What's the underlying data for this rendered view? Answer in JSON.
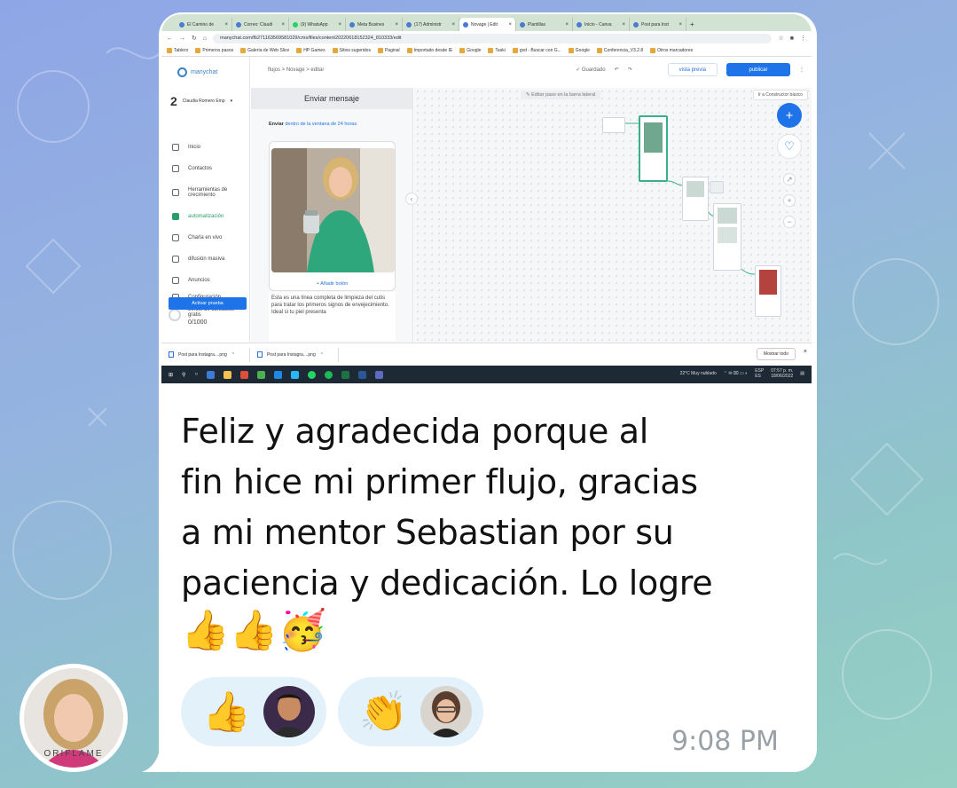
{
  "browser": {
    "tabs": [
      {
        "label": "El Camino de"
      },
      {
        "label": "Correo: Claudi"
      },
      {
        "label": "(9) WhatsApp"
      },
      {
        "label": "Meta Busines"
      },
      {
        "label": "(17) Administr"
      },
      {
        "label": "Novage | Edit",
        "active": true
      },
      {
        "label": "Plantillas"
      },
      {
        "label": "Inicio - Canva"
      },
      {
        "label": "Post para Inst"
      }
    ],
    "url": "manychat.com/fb271163569581029/cms/files/content20220618152324_810333/edit",
    "bookmarks": [
      "Tablero",
      "Primeros pasos",
      "Galería de Web Slice",
      "HP Games",
      "Sitios sugeridos",
      "Paginal",
      "Importado desde IE",
      "Google",
      "Taski",
      "gvd - Buscar con G...",
      "Google",
      "Conferencia_V3.2.8",
      "Otros marcadores"
    ]
  },
  "app": {
    "brand": "manychat",
    "account_name": "Claudia Romero Emp",
    "account_number": "2",
    "nav": [
      {
        "label": "Inicio"
      },
      {
        "label": "Contactos"
      },
      {
        "label": "Herramientas de crecimiento"
      },
      {
        "label": "automatización",
        "selected": true
      },
      {
        "label": "Charla en vivo"
      },
      {
        "label": "difusión masiva"
      },
      {
        "label": "Anuncios"
      },
      {
        "label": "Configuración"
      }
    ],
    "limit_label": "Límite de contactos gratis",
    "limit_value": "0/1000",
    "trial_button": "Activar prueba",
    "breadcrumb": "flujos  >  Novage  >  editar",
    "saved": "Guardado",
    "preview_button": "vista previa",
    "publish_button": "publicar",
    "basic_builder": "Ir a Constructor básico",
    "panel_title": "Enviar mensaje",
    "panel_send_prefix": "Enviar",
    "panel_send_window": "dentro de la ventana de 24 horas",
    "add_button": "+ Añadir botón",
    "message_text": "Esta es una línea completa de limpieza del cutis para tratar los primeros signos de envejecimiento. Ideal si tu piel presenta",
    "canvas_hint": "Editar paso en la barra lateral"
  },
  "downloads": {
    "items": [
      "Post para Instagra....png",
      "Post para Instagra....png"
    ],
    "show_all": "Mostrar todo"
  },
  "taskbar": {
    "weather": "22°C  Muy nublado",
    "lang": "ESP",
    "lang2": "ES",
    "clock": "07:57 p. m.",
    "date": "18/06/2022"
  },
  "message": {
    "lines": [
      "Feliz y agradecida porque al",
      "fin hice mi primer flujo, gracias",
      "a mi mentor Sebastian por su",
      "paciencia y dedicación. Lo logre"
    ],
    "emojis": "👍👍🥳",
    "time": "9:08 PM"
  },
  "reactions": [
    {
      "emoji": "👍"
    },
    {
      "emoji": "👏"
    }
  ],
  "avatar": {
    "label": "ORIFLAME"
  },
  "colors": {
    "accent_blue": "#1e73e8",
    "selected_green": "#2a9d6b",
    "reaction_bg": "#e3f1fb",
    "time_gray": "#9aa1a6"
  }
}
